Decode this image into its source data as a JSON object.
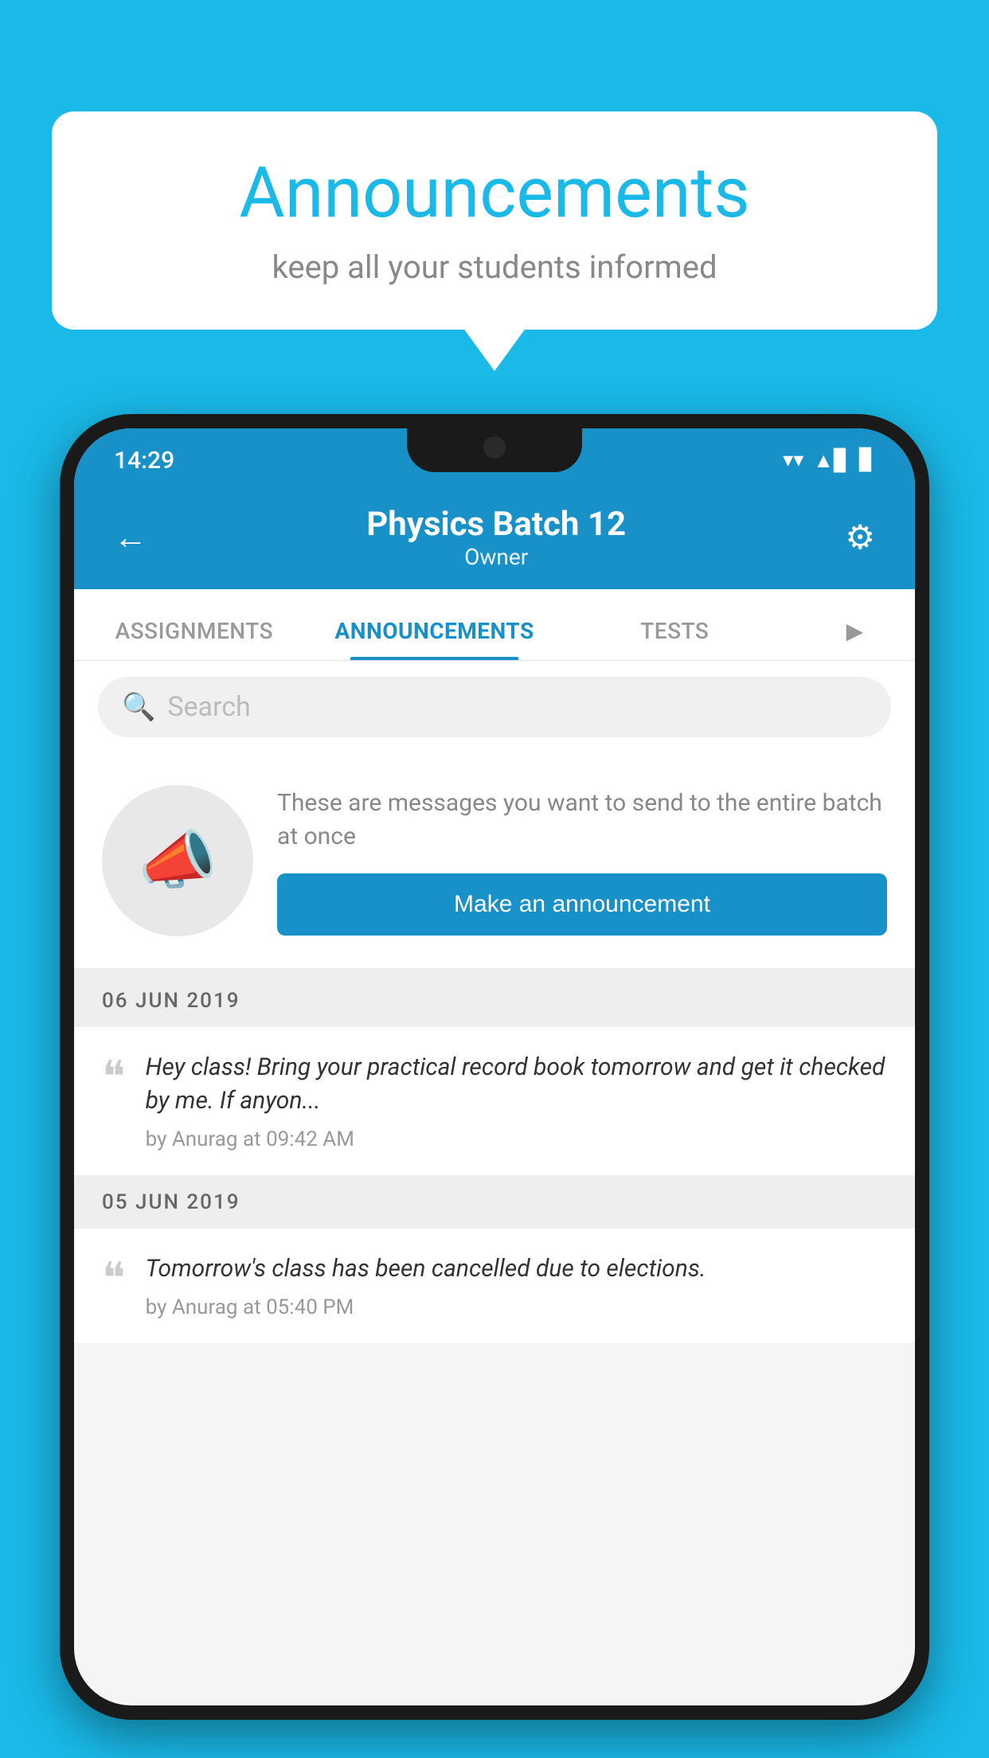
{
  "background": {
    "color": "#1ab9e8"
  },
  "speech_bubble": {
    "title": "Announcements",
    "subtitle": "keep all your students informed"
  },
  "phone": {
    "status_bar": {
      "time": "14:29",
      "wifi": "▼",
      "signal": "▲",
      "battery": "▊"
    },
    "header": {
      "title": "Physics Batch 12",
      "subtitle": "Owner",
      "back_label": "←",
      "settings_label": "⚙"
    },
    "tabs": [
      {
        "label": "ASSIGNMENTS",
        "active": false
      },
      {
        "label": "ANNOUNCEMENTS",
        "active": true
      },
      {
        "label": "TESTS",
        "active": false
      },
      {
        "label": "",
        "active": false,
        "partial": true
      }
    ],
    "search": {
      "placeholder": "Search"
    },
    "announcement_prompt": {
      "description": "These are messages you want to send to the entire batch at once",
      "button_label": "Make an announcement"
    },
    "announcements": [
      {
        "date": "06  JUN  2019",
        "text": "Hey class! Bring your practical record book tomorrow and get it checked by me. If anyon...",
        "meta": "by Anurag at 09:42 AM"
      },
      {
        "date": "05  JUN  2019",
        "text": "Tomorrow's class has been cancelled due to elections.",
        "meta": "by Anurag at 05:40 PM"
      }
    ]
  }
}
